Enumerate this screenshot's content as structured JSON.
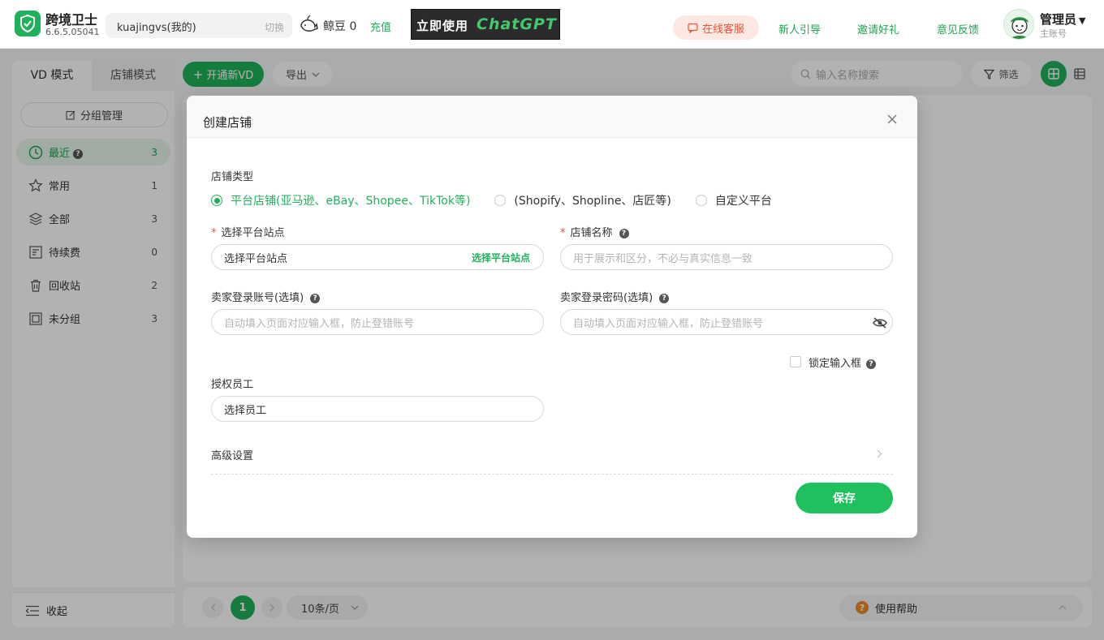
{
  "app": {
    "name": "跨境卫士",
    "version": "6.6.5.05041",
    "account": "kuajingvs(我的)",
    "switch_label": "切换",
    "beans_label": "鲸豆",
    "beans_value": "0",
    "recharge_label": "充值",
    "banner_text_a": "立即使用",
    "banner_text_b": "ChatGPT"
  },
  "topnav": {
    "service": "在线客服",
    "guide": "新人引导",
    "invite": "邀请好礼",
    "feedback": "意见反馈",
    "user_name": "管理员",
    "user_role": "主账号"
  },
  "sidebar": {
    "tab_vd": "VD 模式",
    "tab_store": "店铺模式",
    "group_manage": "分组管理",
    "items": [
      {
        "label": "最近",
        "count": "3",
        "icon": "clock-icon"
      },
      {
        "label": "常用",
        "count": "1",
        "icon": "star-icon"
      },
      {
        "label": "全部",
        "count": "3",
        "icon": "layers-icon"
      },
      {
        "label": "待续费",
        "count": "0",
        "icon": "renew-icon"
      },
      {
        "label": "回收站",
        "count": "2",
        "icon": "trash-icon"
      },
      {
        "label": "未分组",
        "count": "3",
        "icon": "folder-icon"
      }
    ],
    "collapse": "收起"
  },
  "toolbar": {
    "new_vd": "开通新VD",
    "export": "导出",
    "search_placeholder": "输入名称搜索",
    "filter": "筛选"
  },
  "pager": {
    "current": "1",
    "page_size": "10条/页",
    "help": "使用帮助"
  },
  "modal": {
    "title": "创建店铺",
    "store_type_label": "店铺类型",
    "options": [
      "平台店铺(亚马逊、eBay、Shopee、TikTok等)",
      "(Shopify、Shopline、店匠等)",
      "自定义平台"
    ],
    "selected_option": 0,
    "site_label": "选择平台站点",
    "site_value": "选择平台站点",
    "site_action": "选择平台站点",
    "name_label": "店铺名称",
    "name_placeholder": "用于展示和区分，不必与真实信息一致",
    "login_account_label": "卖家登录账号(选填)",
    "login_account_placeholder": "自动填入页面对应输入框，防止登错账号",
    "login_password_label": "卖家登录密码(选填)",
    "login_password_placeholder": "自动填入页面对应输入框，防止登错账号",
    "lock_label": "锁定输入框",
    "staff_label": "授权员工",
    "staff_value": "选择员工",
    "advanced": "高级设置",
    "save": "保存"
  },
  "colors": {
    "accent": "#20b25a",
    "danger": "#f04b3a",
    "service_bg": "#fde8e2"
  }
}
